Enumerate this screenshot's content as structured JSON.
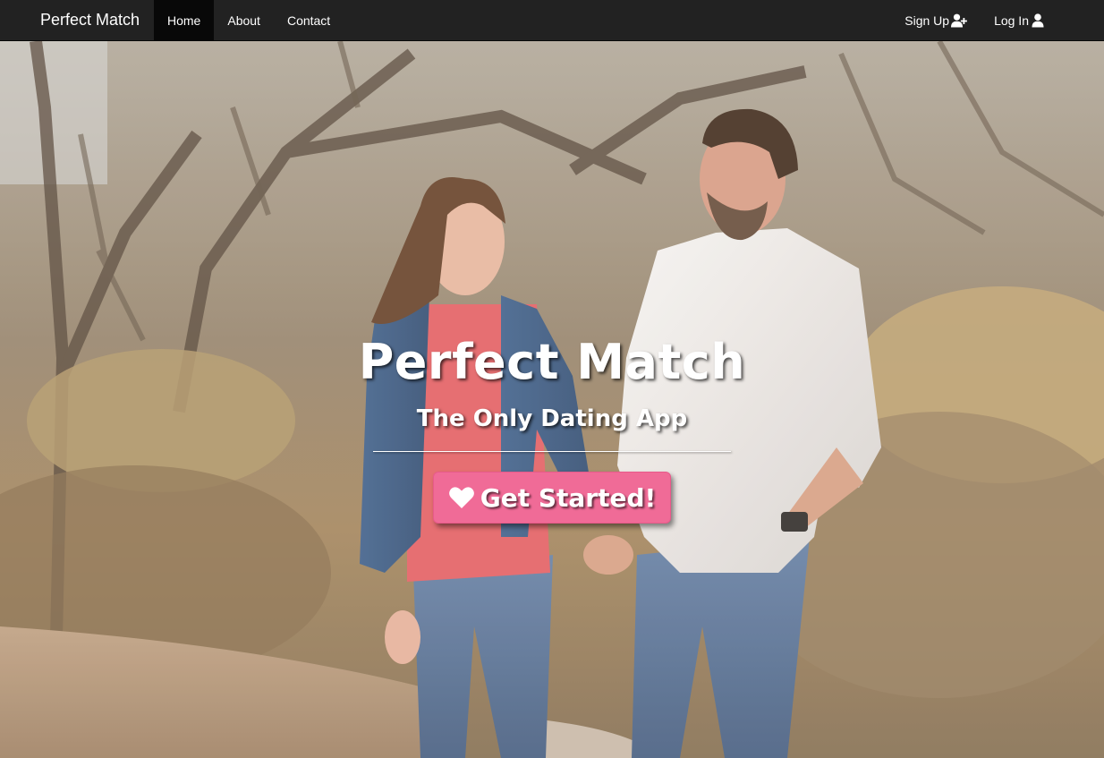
{
  "navbar": {
    "brand": "Perfect Match",
    "links": [
      {
        "label": "Home",
        "active": true
      },
      {
        "label": "About",
        "active": false
      },
      {
        "label": "Contact",
        "active": false
      }
    ],
    "right_links": [
      {
        "label": "Sign Up",
        "icon": "user-plus-icon"
      },
      {
        "label": "Log In",
        "icon": "user-icon"
      }
    ]
  },
  "hero": {
    "title": "Perfect Match",
    "subtitle": "The Only Dating App",
    "cta_label": "Get Started!",
    "cta_icon": "heart-icon",
    "background_image": "couple-walking-outdoors-photo"
  },
  "colors": {
    "navbar_bg": "#222222",
    "active_nav_bg": "#080808",
    "cta_bg": "#f06b97",
    "text": "#ffffff"
  }
}
